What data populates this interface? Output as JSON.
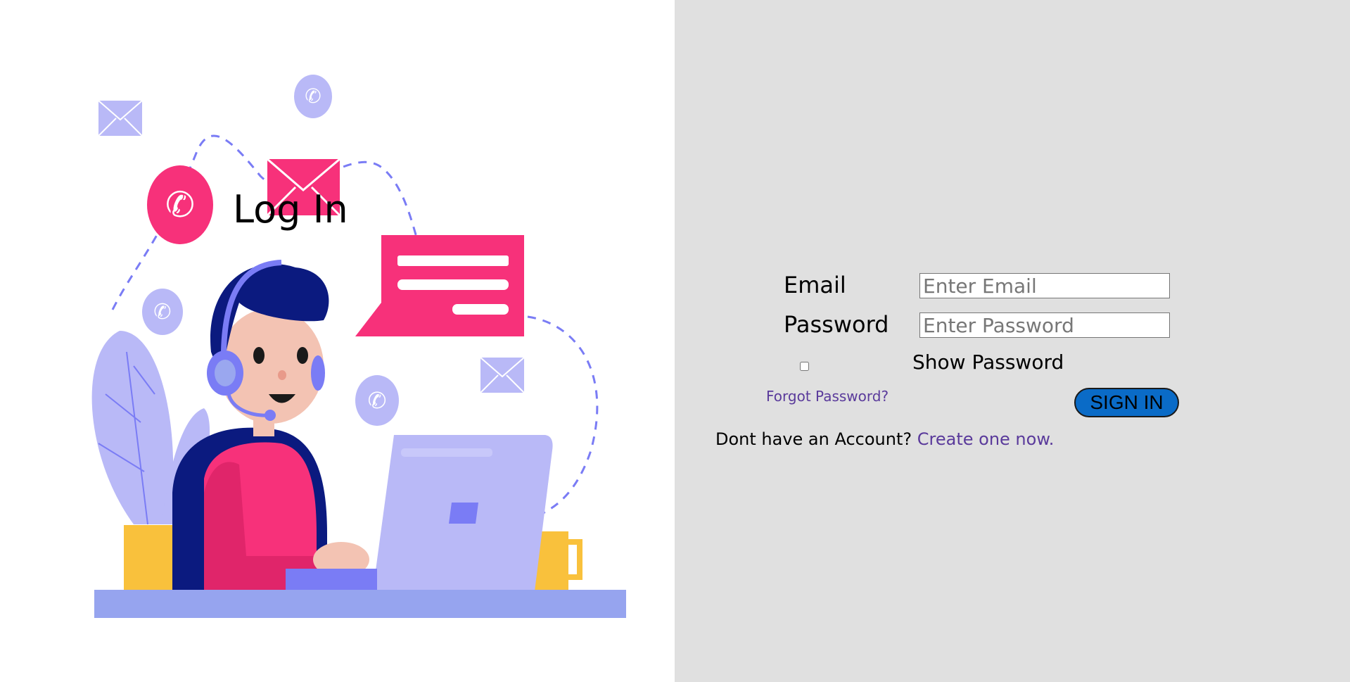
{
  "login": {
    "title": "Log In",
    "email_label": "Email",
    "email_placeholder": "Enter Email",
    "password_label": "Password",
    "password_placeholder": "Enter Password",
    "show_password_label": "Show Password",
    "show_password_checked": false,
    "forgot_password": "Forgot Password?",
    "sign_in_button": "SIGN IN",
    "no_account_text": "Dont have an Account?",
    "create_account_link": "Create one now."
  },
  "illustration": {
    "subject": "customer-support-agent-with-headset-and-laptop",
    "icons": [
      "envelope-icon",
      "phone-icon",
      "chat-bubble-icon",
      "mug-icon",
      "plant-icon"
    ]
  },
  "colors": {
    "right_panel_bg": "#e0e0e0",
    "accent_pink": "#f7317a",
    "accent_lavender": "#b9b9f7",
    "accent_blue": "#7a7cf5",
    "button_blue": "#0a6bc7",
    "link_purple": "#5a3a9b"
  }
}
